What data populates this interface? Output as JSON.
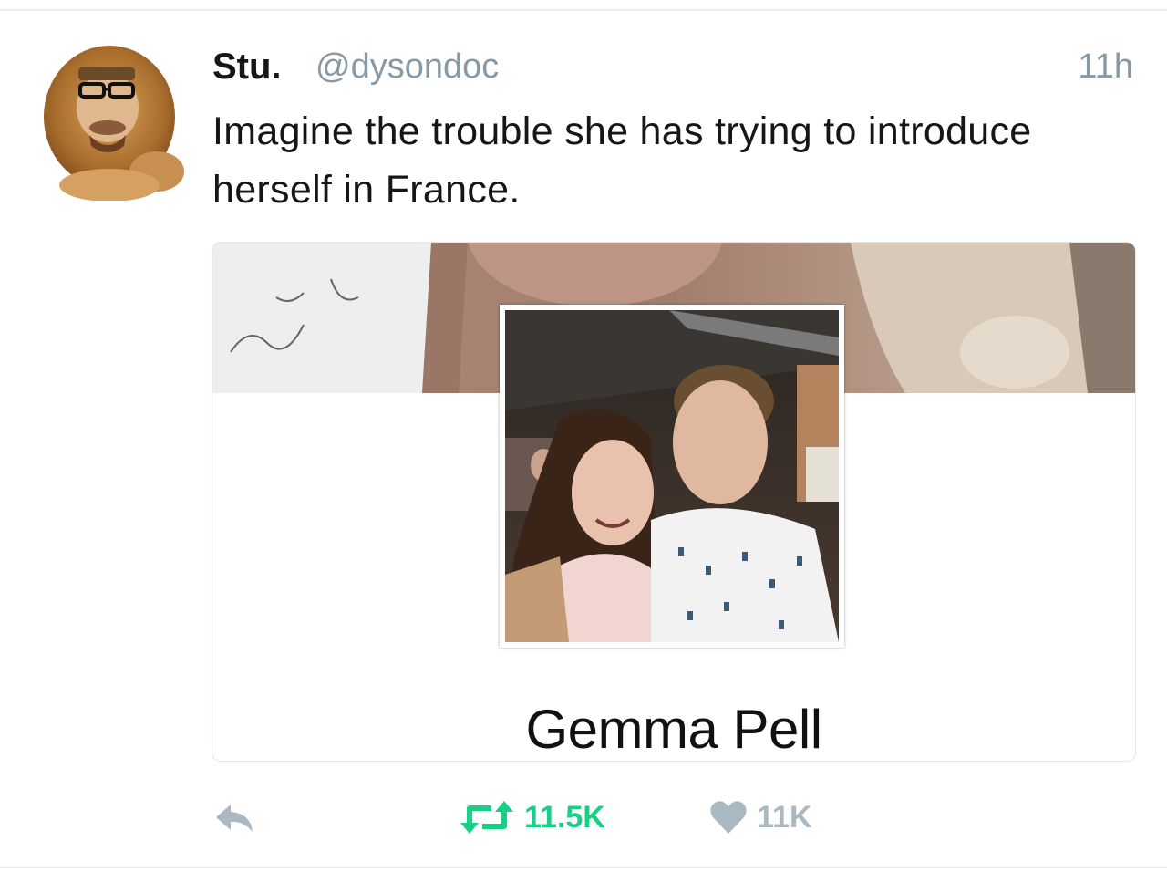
{
  "tweet": {
    "display_name": "Stu.",
    "handle": "@dysondoc",
    "timestamp": "11h",
    "text": "Imagine the trouble she has trying to introduce herself in France.",
    "avatar_icon": "lion-avatar",
    "media": {
      "profile_name": "Gemma Pell"
    },
    "actions": {
      "reply_icon": "reply-icon",
      "retweet_icon": "retweet-icon",
      "retweet_count": "11.5K",
      "like_icon": "heart-icon",
      "like_count": "11K"
    }
  },
  "colors": {
    "text_primary": "#14171a",
    "text_secondary": "#8899a6",
    "retweet_active": "#19cf86",
    "action_muted": "#aab8c2",
    "border": "#e1e8ed"
  }
}
